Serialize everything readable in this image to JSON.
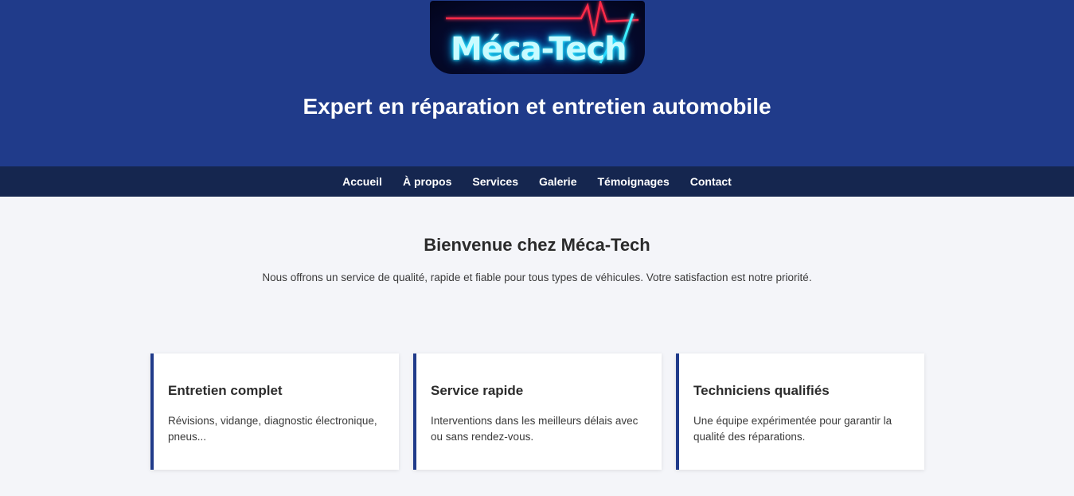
{
  "header": {
    "logo_text": "Méca-Tech",
    "tagline": "Expert en réparation et entretien automobile"
  },
  "nav": {
    "items": [
      "Accueil",
      "À propos",
      "Services",
      "Galerie",
      "Témoignages",
      "Contact"
    ]
  },
  "welcome": {
    "title": "Bienvenue chez Méca-Tech",
    "text": "Nous offrons un service de qualité, rapide et fiable pour tous types de véhicules. Votre satisfaction est notre priorité."
  },
  "cards": [
    {
      "title": "Entretien complet",
      "text": "Révisions, vidange, diagnostic électronique, pneus..."
    },
    {
      "title": "Service rapide",
      "text": "Interventions dans les meilleurs délais avec ou sans rendez-vous."
    },
    {
      "title": "Techniciens qualifiés",
      "text": "Une équipe expérimentée pour garantir la qualité des réparations."
    }
  ],
  "colors": {
    "header_bg": "#203b8a",
    "nav_bg": "#15264f",
    "page_bg": "#f4f5f9",
    "card_accent": "#203b8a",
    "logo_glow": "#19d6ff",
    "pulse_line": "#ff2a4a"
  }
}
